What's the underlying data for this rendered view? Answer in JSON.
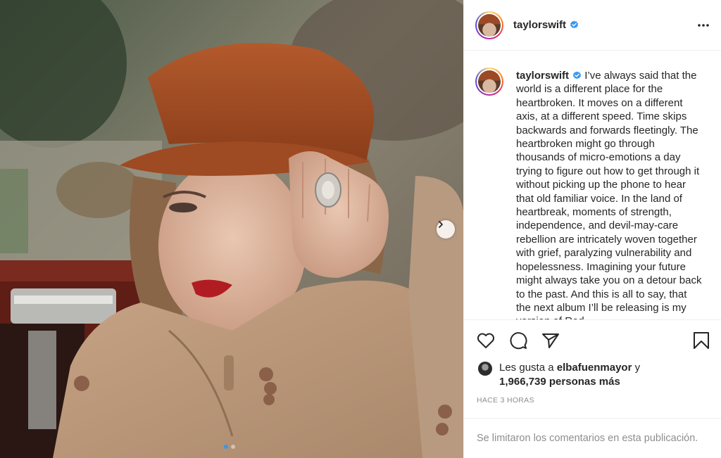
{
  "post": {
    "username": "taylorswift",
    "verified": true,
    "caption": "I’ve always said that the world is a different place for the heartbroken. It moves on a different axis, at a different speed. Time skips backwards and forwards fleetingly. The heartbroken might go through thousands of micro-emotions a day trying to figure out how to get through it without picking up the phone to hear that old familiar voice. In the land of heartbreak, moments of strength, independence, and devil-may-care rebellion are intricately woven together with grief, paralyzing vulnerability and hopelessness. Imagining your future might always take you on a detour back to the past. And this is all to say, that the next album I’ll be releasing is my version of Red.",
    "likes_prefix": "Les gusta a",
    "liked_by": "elbafuenmayor",
    "likes_joiner": "y",
    "likes_rest": "1,966,739 personas más",
    "timestamp": "HACE 3 HORAS",
    "comments_note": "Se limitaron los comentarios en esta publicación."
  },
  "media": {
    "slides_total": 2,
    "slide_current": 1
  },
  "icons": {
    "verified": "verified-badge-icon",
    "more": "more-options-icon",
    "like": "heart-icon",
    "comment": "comment-bubble-icon",
    "share": "paper-plane-icon",
    "save": "bookmark-icon",
    "next": "chevron-right-icon"
  },
  "colors": {
    "verified_blue": "#3897f0",
    "text": "#262626",
    "muted": "#8e8e8e",
    "divider": "#efefef"
  }
}
